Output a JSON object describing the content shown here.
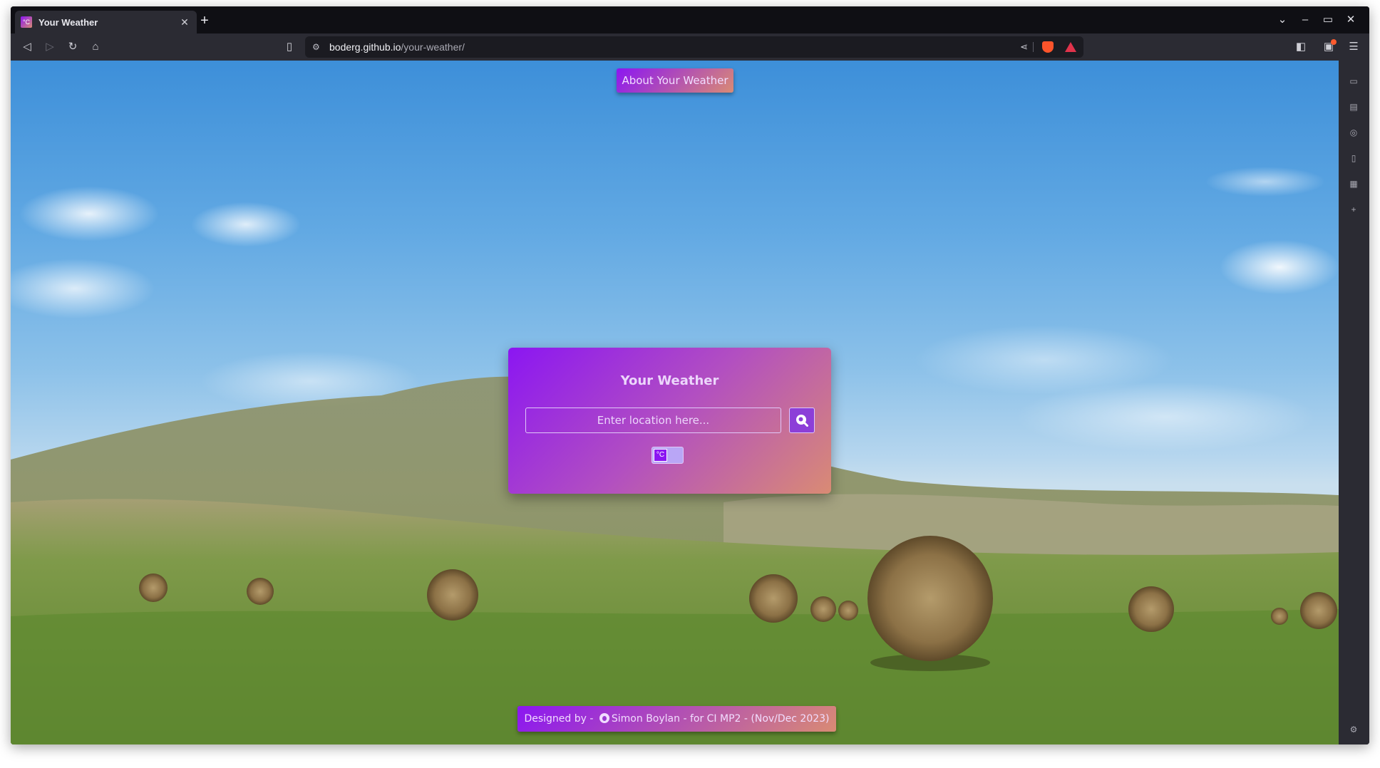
{
  "browser": {
    "tab": {
      "title": "Your Weather",
      "favicon_text": "°C"
    },
    "new_tab_label": "+",
    "url": {
      "domain": "boderg.github.io",
      "path": "/your-weather/"
    }
  },
  "page": {
    "about_button_label": "About Your Weather",
    "card": {
      "title": "Your Weather",
      "search_placeholder": "Enter location here...",
      "unit_toggle_label": "°C"
    },
    "footer": {
      "prefix": "Designed by - ",
      "author_link": "Simon Boylan",
      "suffix": " - for CI MP2 - (Nov/Dec 2023)"
    }
  },
  "colors": {
    "accent_start": "#8b16f2",
    "accent_end": "#d98b74",
    "text_light": "#ecd6fb"
  },
  "icons": {
    "search": "search-icon",
    "github": "github-icon"
  }
}
